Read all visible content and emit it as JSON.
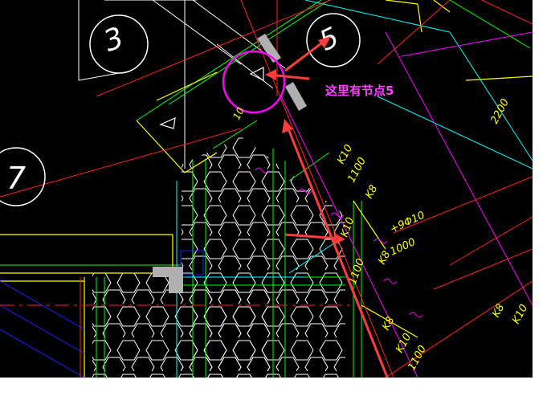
{
  "colors": {
    "background": "#000000",
    "frame": "#ffffff",
    "red": "#ff2020",
    "yellow": "#ffff00",
    "green": "#00ff00",
    "cyan": "#00ffff",
    "magenta": "#ff00ff",
    "white": "#ffffff",
    "blue": "#2020ff",
    "grey": "#b0b0b0",
    "arrow": "#ff3c3c",
    "note": "#ff40ff"
  },
  "axis_bubbles": {
    "b3": "3",
    "b5": "5",
    "b7": "7"
  },
  "annotation": {
    "note": "这里有节点5"
  },
  "labels": {
    "k10_a": "K10",
    "d1100_a": "1100",
    "k8_a": "K8",
    "k10_b": "K10",
    "phi": "+9Φ10",
    "d1000": "1000",
    "k8_b": "K8",
    "d1100_b": "1100",
    "k8_c": "K8",
    "k10_c": "K10",
    "d1100_c": "1100",
    "d2200": "2200",
    "k8_d": "K8",
    "k10_d": "K10",
    "d10": "10"
  }
}
